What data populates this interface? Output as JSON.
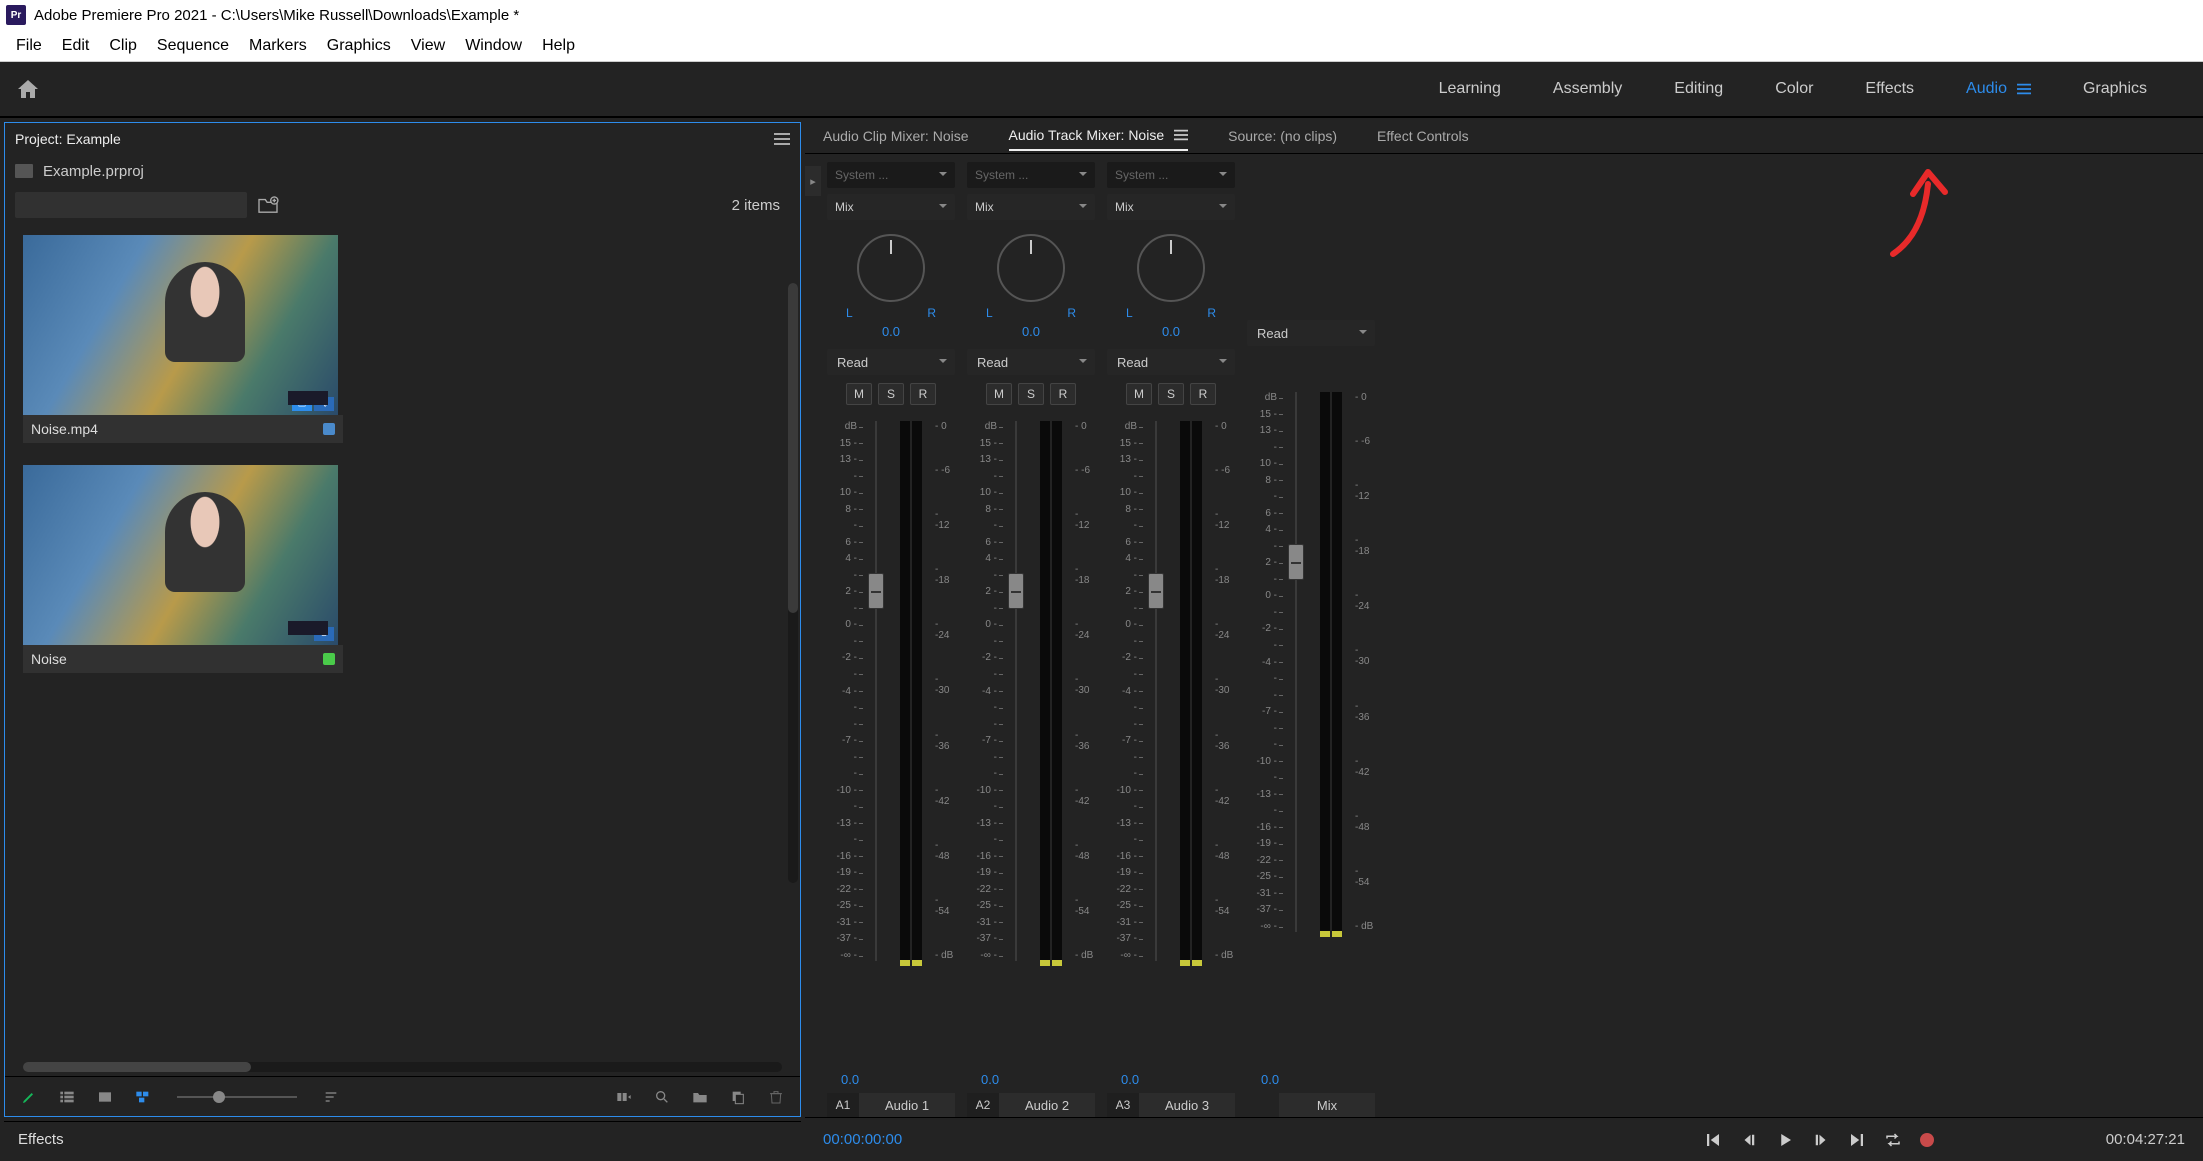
{
  "title_bar": {
    "app_icon_text": "Pr",
    "title": "Adobe Premiere Pro 2021 - C:\\Users\\Mike Russell\\Downloads\\Example *"
  },
  "menu": [
    "File",
    "Edit",
    "Clip",
    "Sequence",
    "Markers",
    "Graphics",
    "View",
    "Window",
    "Help"
  ],
  "workspaces": {
    "items": [
      "Learning",
      "Assembly",
      "Editing",
      "Color",
      "Effects",
      "Audio",
      "Graphics"
    ],
    "active": "Audio"
  },
  "project_panel": {
    "title": "Project: Example",
    "file_name": "Example.prproj",
    "item_count": "2 items",
    "search_placeholder": "",
    "media": [
      {
        "name": "Noise.mp4",
        "chip": "chip-blue"
      },
      {
        "name": "Noise",
        "chip": "chip-green"
      }
    ]
  },
  "effects_panel": {
    "title": "Effects"
  },
  "source_tabs": {
    "items": [
      {
        "label": "Audio Clip Mixer: Noise",
        "active": false
      },
      {
        "label": "Audio Track Mixer: Noise",
        "active": true
      },
      {
        "label": "Source: (no clips)",
        "active": false
      },
      {
        "label": "Effect Controls",
        "active": false
      }
    ]
  },
  "mixer": {
    "system_label": "System ...",
    "mix_label": "Mix",
    "read_label": "Read",
    "pan_left": "L",
    "pan_right": "R",
    "pan_value": "0.0",
    "buttons": {
      "m": "M",
      "s": "S",
      "r": "R"
    },
    "fader_scale_left": [
      "dB",
      "15 -",
      "13 -",
      "-",
      "10 -",
      "8 -",
      "-",
      "6 -",
      "4 -",
      "-",
      "2 -",
      "-",
      "0 -",
      "-",
      "-2 -",
      "-",
      "-4 -",
      "-",
      "-",
      "-7 -",
      "-",
      "-",
      "-10 -",
      "-",
      "-13 -",
      "-",
      "-16 -",
      "-19 -",
      "-22 -",
      "-25 -",
      "-31 -",
      "-37 -",
      "-∞ -"
    ],
    "meter_scale_right": [
      "- 0",
      "",
      "- -6",
      "",
      "- -12",
      "",
      "- -18",
      "",
      "- -24",
      "",
      "- -30",
      "",
      "- -36",
      "",
      "- -42",
      "",
      "- -48",
      "",
      "- -54",
      "",
      "- dB"
    ],
    "fader_value": "0.0",
    "channels": [
      {
        "id": "A1",
        "name": "Audio 1"
      },
      {
        "id": "A2",
        "name": "Audio 2"
      },
      {
        "id": "A3",
        "name": "Audio 3"
      }
    ],
    "master": {
      "id": "",
      "name": "Mix"
    }
  },
  "transport": {
    "tc_in": "00:00:00:00",
    "tc_out": "00:04:27:21"
  }
}
